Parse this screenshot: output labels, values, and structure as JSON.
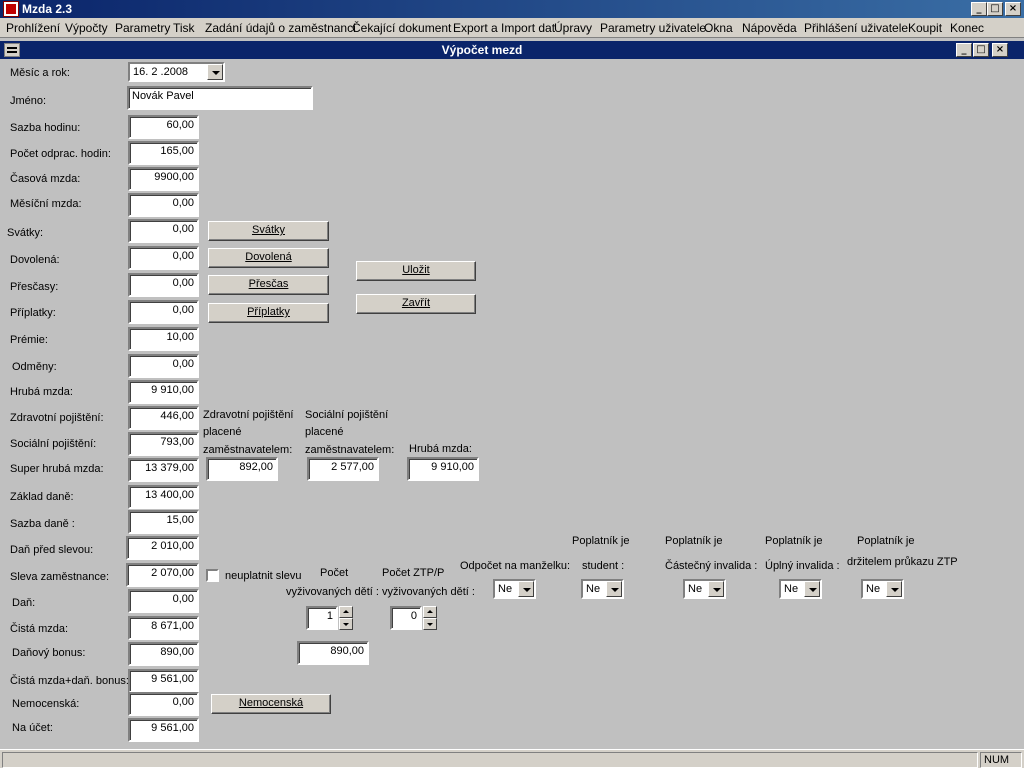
{
  "window": {
    "title": "Mzda 2.3"
  },
  "menu": [
    "Prohlížení",
    "Výpočty",
    "Parametry",
    "Tisk",
    "Zadání údajů o zaměstnanci",
    "Čekající dokument",
    "Export a Import dat",
    "Úpravy",
    "Parametry uživatele",
    "Okna",
    "Nápověda",
    "Přihlášení uživatele",
    "Koupit",
    "Konec"
  ],
  "child": {
    "title": "Výpočet mezd"
  },
  "form": {
    "month_label": "Měsíc a rok:",
    "month_value": "16. 2 .2008",
    "name_label": "Jméno:",
    "name_value": "Novák Pavel",
    "rows": [
      {
        "label": "Sazba hodinu:",
        "value": "60,00"
      },
      {
        "label": "Počet odprac. hodin:",
        "value": "165,00"
      },
      {
        "label": "Časová mzda:",
        "value": "9900,00"
      },
      {
        "label": "Měsíční mzda:",
        "value": "0,00"
      },
      {
        "label": "Svátky:",
        "value": "0,00"
      },
      {
        "label": "Dovolená:",
        "value": "0,00"
      },
      {
        "label": "Přesčasy:",
        "value": "0,00"
      },
      {
        "label": "Příplatky:",
        "value": "0,00"
      },
      {
        "label": "Prémie:",
        "value": "10,00"
      },
      {
        "label": "Odměny:",
        "value": "0,00"
      },
      {
        "label": "Hrubá mzda:",
        "value": "9 910,00"
      },
      {
        "label": "Zdravotní pojištění:",
        "value": "446,00"
      },
      {
        "label": "Sociální pojištění:",
        "value": "793,00"
      },
      {
        "label": "Super hrubá mzda:",
        "value": "13 379,00"
      },
      {
        "label": "Základ daně:",
        "value": "13 400,00"
      },
      {
        "label": "Sazba daně :",
        "value": "15,00"
      },
      {
        "label": "Daň před slevou:",
        "value": "2 010,00"
      },
      {
        "label": "Sleva zaměstnance:",
        "value": "2 070,00"
      },
      {
        "label": "Daň:",
        "value": "0,00"
      },
      {
        "label": "Čistá mzda:",
        "value": "8 671,00"
      },
      {
        "label": "Daňový bonus:",
        "value": "890,00"
      },
      {
        "label": "Čistá mzda+daň. bonus:",
        "value": "9 561,00"
      },
      {
        "label": "Nemocenská:",
        "value": "0,00"
      },
      {
        "label": "Na účet:",
        "value": "9 561,00"
      }
    ]
  },
  "buttons": {
    "svatky": "Svátky",
    "dovolena": "Dovolená",
    "prescas": "Přesčas",
    "priplatky": "Příplatky",
    "ulozit": "Uložit",
    "zavrit": "Zavřít",
    "nemocenska": "Nemocenská"
  },
  "employer": {
    "zdrav_label": [
      "Zdravotní pojištění",
      "placené",
      "zaměstnavatelem:"
    ],
    "zdrav_value": "892,00",
    "soc_label": [
      "Sociální pojištění",
      "placené",
      "zaměstnavatelem:"
    ],
    "soc_value": "2 577,00",
    "hruba_label": "Hrubá mzda:",
    "hruba_value": "9 910,00"
  },
  "discount": {
    "checkbox_label": "neuplatnit slevu",
    "children_label": [
      "Počet",
      "vyživovaných dětí :"
    ],
    "children_value": "1",
    "ztp_label": [
      "Počet ZTP/P",
      "vyživovaných dětí :"
    ],
    "ztp_value": "0",
    "bonus_value": "890,00",
    "spouse_label": "Odpočet na manželku:",
    "spouse_value": "Ne",
    "student_label": [
      "Poplatník je",
      "student :"
    ],
    "student_value": "Ne",
    "partial_label": [
      "Poplatník je",
      "Částečný invalida :"
    ],
    "partial_value": "Ne",
    "full_label": [
      "Poplatník je",
      "Úplný invalida :"
    ],
    "full_value": "Ne",
    "ztp_holder_label": [
      "Poplatník je",
      "držitelem průkazu ZTP"
    ],
    "ztp_holder_value": "Ne"
  },
  "status": {
    "num": "NUM"
  }
}
